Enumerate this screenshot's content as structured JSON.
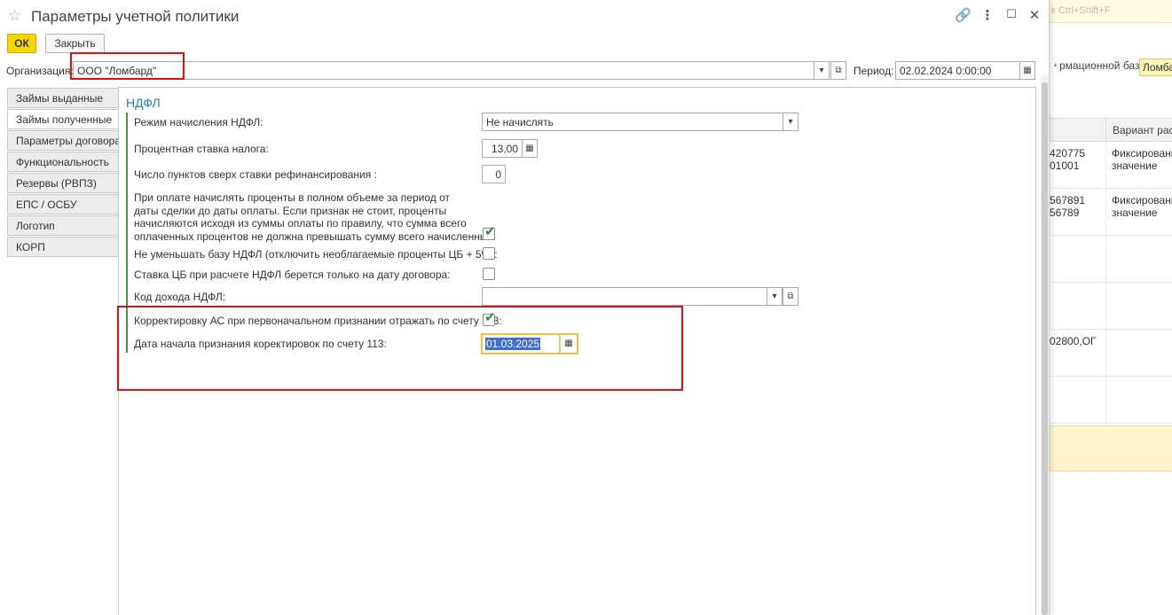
{
  "window": {
    "title": "Параметры учетной политики",
    "star": "☆",
    "link_icon": "🔗",
    "more_icon": "⋮",
    "maximize_icon": "☐",
    "close_icon": "✕"
  },
  "toolbar": {
    "ok_label": "ОК",
    "close_label": "Закрыть"
  },
  "org": {
    "label": "Организация:",
    "value": "ООО \"Ломбард\"",
    "dropdown_icon": "▾",
    "open_icon": "⧉"
  },
  "period": {
    "label": "Период:",
    "value": "02.02.2024  0:00:00",
    "calendar_icon": "▦"
  },
  "tabs": [
    {
      "label": "Займы выданные"
    },
    {
      "label": "Займы полученные"
    },
    {
      "label": "Параметры договора"
    },
    {
      "label": "Функциональность"
    },
    {
      "label": "Резервы (РВПЗ)"
    },
    {
      "label": "ЕПС / ОСБУ"
    },
    {
      "label": "Логотип"
    },
    {
      "label": "КОРП"
    }
  ],
  "active_tab_index": 1,
  "section": {
    "title": "НДФЛ",
    "mode": {
      "label": "Режим начисления НДФЛ:",
      "value": "Не начислять",
      "dropdown_icon": "▾"
    },
    "rate": {
      "label": "Процентная ставка налога:",
      "value": "13,00",
      "calc_icon": "▦"
    },
    "points": {
      "label": "Число пунктов сверх ставки рефинансирования :",
      "value": "0"
    },
    "full_interest": {
      "label_lines": [
        "При оплате начислять проценты в полном объеме за период от",
        "даты сделки до даты оплаты. Если признак не стоит, проценты",
        "начисляются исходя из суммы оплаты по правилу, что сумма всего",
        "оплаченных процентов не должна превышать сумму всего начисленных:"
      ],
      "checked": true
    },
    "no_reduce": {
      "label": "Не уменьшать базу НДФЛ (отключить необлагаемые проценты ЦБ + 5%):",
      "checked": false
    },
    "cb_rate": {
      "label": "Ставка ЦБ при расчете НДФЛ берется только на дату договора:",
      "checked": false
    },
    "income_code": {
      "label": "Код дохода НДФЛ:",
      "value": "",
      "dropdown_icon": "▾",
      "open_icon": "⧉"
    },
    "correction": {
      "label": "Корректировку АС при первоначальном признании отражать по счету 113:",
      "checked": true
    },
    "start_date": {
      "label": "Дата начала признания коректировок по счету 113:",
      "value": "01.03.2025",
      "calendar_icon": "▦"
    },
    "check_mark": "✔"
  },
  "background": {
    "search_hint": "к Ctrl+Shift+F",
    "infobase_label": "рмационной базы:",
    "infobase_value": "Ломба",
    "column_header": "Вариант расч",
    "rows": [
      {
        "c1": [
          "420775",
          "01001"
        ],
        "c2": [
          "Фиксированн",
          "значение"
        ]
      },
      {
        "c1": [
          "567891",
          "56789"
        ],
        "c2": [
          "Фиксированн",
          "значение"
        ]
      },
      {
        "c1": [],
        "c2": []
      },
      {
        "c1": [],
        "c2": []
      },
      {
        "c1": [
          "02800,ОГ"
        ],
        "c2": []
      },
      {
        "c1": [],
        "c2": []
      }
    ],
    "scroll_up_icon": "▲"
  }
}
